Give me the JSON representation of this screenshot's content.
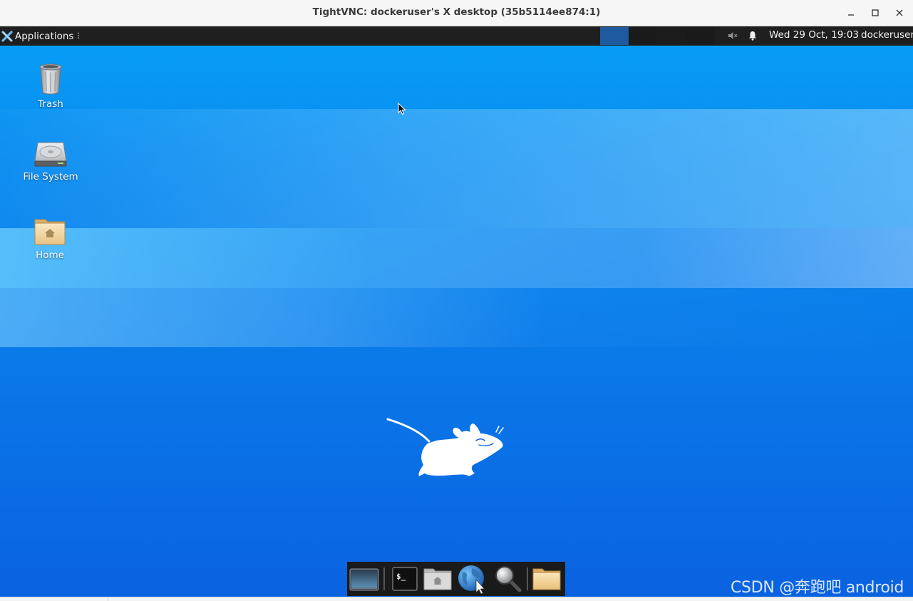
{
  "window": {
    "title": "TightVNC: dockeruser's X desktop (35b5114ee874:1)",
    "controls": {
      "minimize": "–",
      "maximize": "□",
      "close": "✕"
    }
  },
  "panel": {
    "applications_label": "Applications",
    "applications_handle": "⠇",
    "workspaces": [
      "workspace-1",
      "workspace-2",
      "workspace-3",
      "workspace-4"
    ],
    "active_workspace": "workspace-1",
    "tray": {
      "volume_icon": "volume-muted-icon",
      "notification_icon": "bell-icon"
    },
    "clock": "Wed 29 Oct, 19:03",
    "user": "dockeruser"
  },
  "desktop": {
    "icons": [
      {
        "label": "Trash",
        "icon": "trash-icon"
      },
      {
        "label": "File System",
        "icon": "hard-drive-icon"
      },
      {
        "label": "Home",
        "icon": "home-folder-icon"
      }
    ],
    "background_logo": "xfce-mouse-logo"
  },
  "dock": {
    "items": [
      {
        "name": "show-desktop",
        "icon": "show-desktop-icon"
      },
      {
        "name": "terminal",
        "icon": "terminal-icon"
      },
      {
        "name": "file-manager",
        "icon": "home-folder-icon"
      },
      {
        "name": "web-browser",
        "icon": "globe-icon"
      },
      {
        "name": "app-finder",
        "icon": "magnifier-icon"
      },
      {
        "name": "folder",
        "icon": "folder-icon"
      }
    ]
  },
  "watermark": "CSDN @奔跑吧 android",
  "colors": {
    "panel_bg": "#1f1f1f",
    "active_workspace": "#1e5aa0",
    "desktop_top": "#079cf6",
    "desktop_bottom": "#0a62e0"
  }
}
